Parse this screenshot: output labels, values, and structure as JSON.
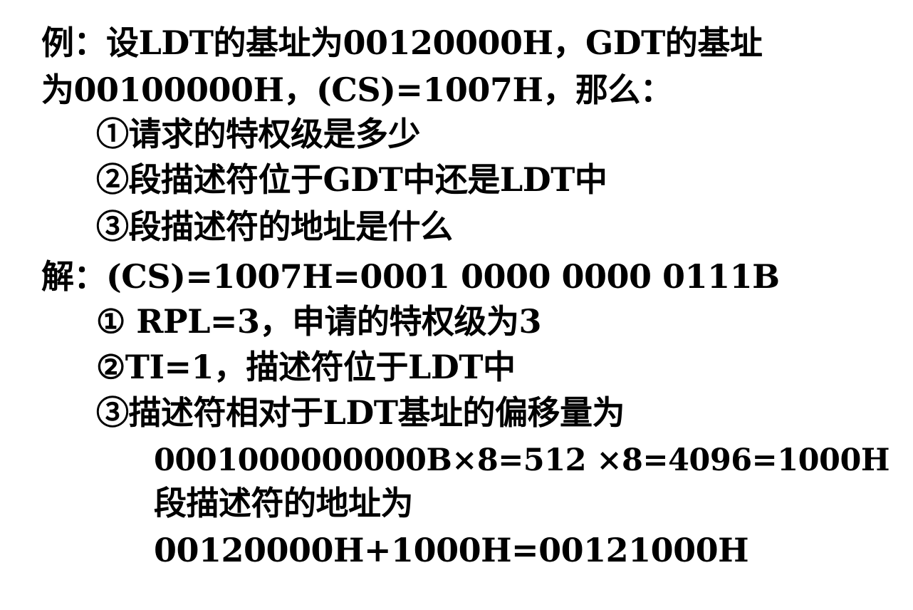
{
  "slide": {
    "lines": [
      "例：设LDT的基址为00120000H，GDT的基址",
      "为00100000H，(CS)=1007H，那么：",
      "①请求的特权级是多少",
      "②段描述符位于GDT中还是LDT中",
      "③段描述符的地址是什么",
      "解：(CS)=1007H=0001 0000 0000 0111B",
      "① RPL=3，申请的特权级为3",
      "②TI=1，描述符位于LDT中",
      "③描述符相对于LDT基址的偏移量为",
      "0001000000000B×8=512 ×8=4096=1000H",
      "段描述符的地址为",
      "00120000H+1000H=00121000H"
    ]
  }
}
